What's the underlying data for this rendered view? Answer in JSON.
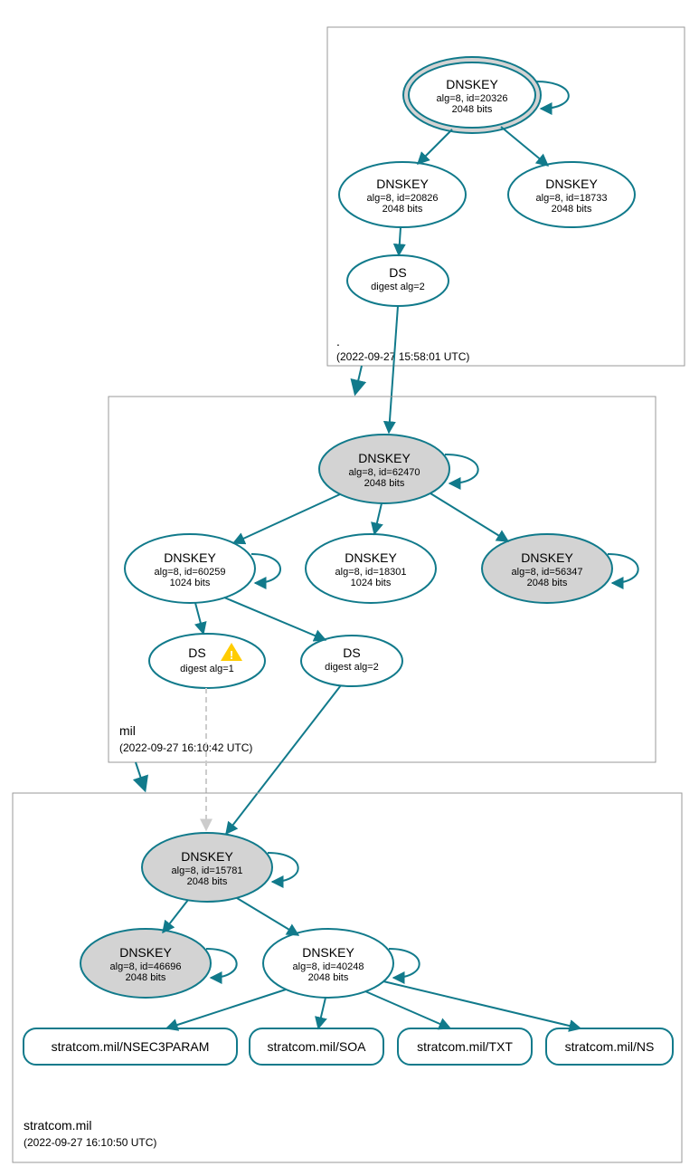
{
  "zones": {
    "root": {
      "label": ".",
      "timestamp": "(2022-09-27 15:58:01 UTC)",
      "dnskey_ksk": {
        "title": "DNSKEY",
        "sub1": "alg=8, id=20326",
        "sub2": "2048 bits"
      },
      "dnskey_zsk1": {
        "title": "DNSKEY",
        "sub1": "alg=8, id=20826",
        "sub2": "2048 bits"
      },
      "dnskey_zsk2": {
        "title": "DNSKEY",
        "sub1": "alg=8, id=18733",
        "sub2": "2048 bits"
      },
      "ds": {
        "title": "DS",
        "sub1": "digest alg=2"
      }
    },
    "mil": {
      "label": "mil",
      "timestamp": "(2022-09-27 16:10:42 UTC)",
      "dnskey_ksk": {
        "title": "DNSKEY",
        "sub1": "alg=8, id=62470",
        "sub2": "2048 bits"
      },
      "dnskey_zsk1": {
        "title": "DNSKEY",
        "sub1": "alg=8, id=60259",
        "sub2": "1024 bits"
      },
      "dnskey_zsk2": {
        "title": "DNSKEY",
        "sub1": "alg=8, id=18301",
        "sub2": "1024 bits"
      },
      "dnskey_sep": {
        "title": "DNSKEY",
        "sub1": "alg=8, id=56347",
        "sub2": "2048 bits"
      },
      "ds1": {
        "title": "DS",
        "sub1": "digest alg=1"
      },
      "ds2": {
        "title": "DS",
        "sub1": "digest alg=2"
      }
    },
    "stratcom": {
      "label": "stratcom.mil",
      "timestamp": "(2022-09-27 16:10:50 UTC)",
      "dnskey_ksk": {
        "title": "DNSKEY",
        "sub1": "alg=8, id=15781",
        "sub2": "2048 bits"
      },
      "dnskey_sep": {
        "title": "DNSKEY",
        "sub1": "alg=8, id=46696",
        "sub2": "2048 bits"
      },
      "dnskey_zsk": {
        "title": "DNSKEY",
        "sub1": "alg=8, id=40248",
        "sub2": "2048 bits"
      },
      "rr_nsec3": "stratcom.mil/NSEC3PARAM",
      "rr_soa": "stratcom.mil/SOA",
      "rr_txt": "stratcom.mil/TXT",
      "rr_ns": "stratcom.mil/NS"
    }
  }
}
